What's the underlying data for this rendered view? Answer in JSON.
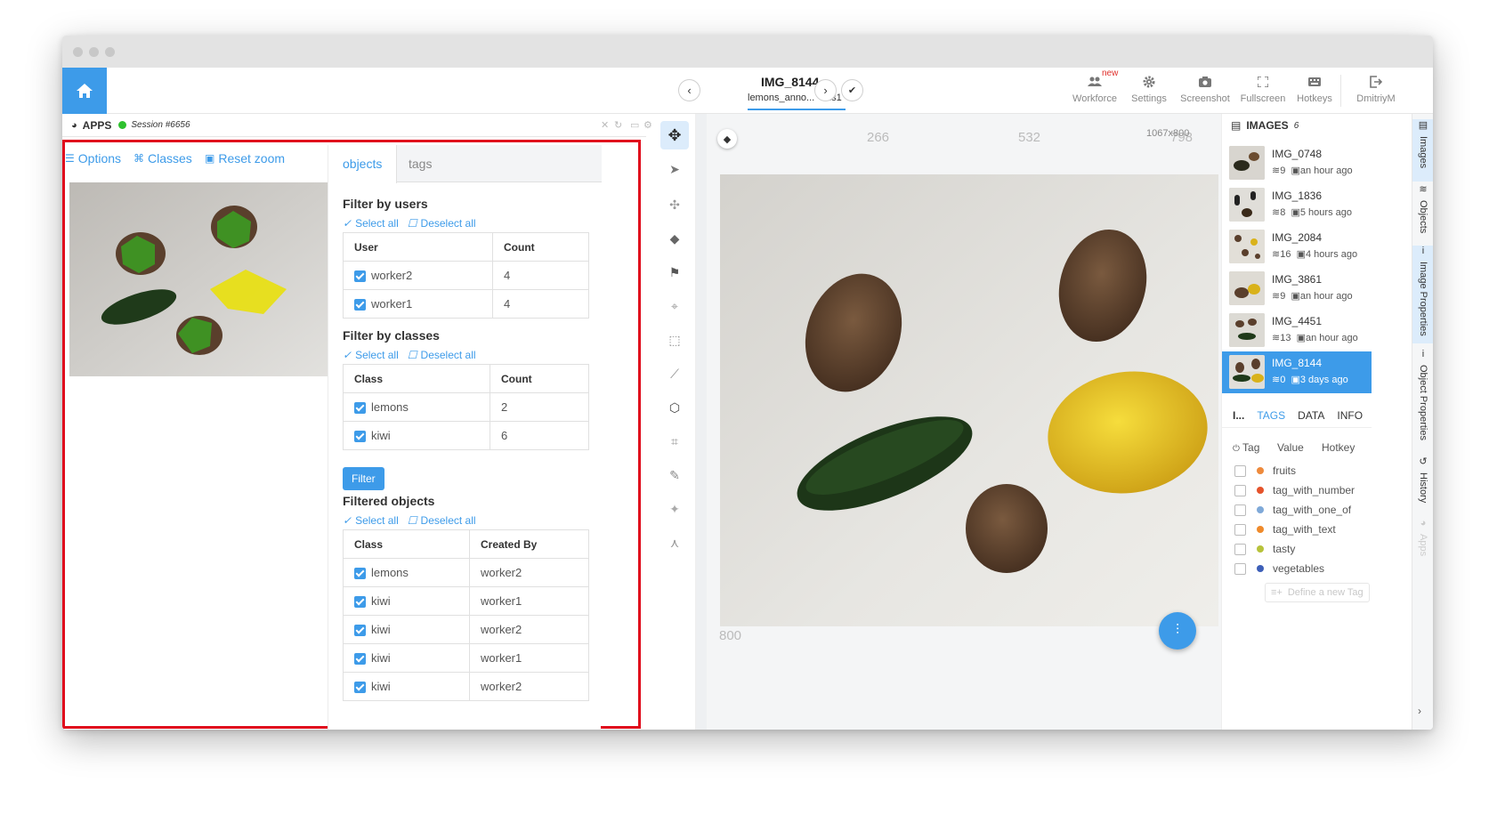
{
  "header": {
    "image_title": "IMG_8144",
    "breadcrumb_project": "lemons_anno...",
    "breadcrumb_dataset": "ds1",
    "toolbar": [
      {
        "label": "Workforce",
        "icon": "workforce-icon",
        "badge": "new"
      },
      {
        "label": "Settings",
        "icon": "gear-icon"
      },
      {
        "label": "Screenshot",
        "icon": "camera-icon"
      },
      {
        "label": "Fullscreen",
        "icon": "fullscreen-icon"
      },
      {
        "label": "Hotkeys",
        "icon": "keyboard-icon"
      },
      {
        "label": "DmitriyM",
        "icon": "logout-icon"
      }
    ]
  },
  "apps": {
    "title": "APPS",
    "session": "Session #6656",
    "links": {
      "options": "Options",
      "classes": "Classes",
      "reset_zoom": "Reset zoom"
    }
  },
  "filter_panel": {
    "tabs": [
      "objects",
      "tags"
    ],
    "active_tab": "objects",
    "select_all": "Select all",
    "deselect_all": "Deselect all",
    "filter_by_users": {
      "title": "Filter by users",
      "headers": [
        "User",
        "Count"
      ],
      "rows": [
        {
          "name": "worker2",
          "count": "4"
        },
        {
          "name": "worker1",
          "count": "4"
        }
      ]
    },
    "filter_by_classes": {
      "title": "Filter by classes",
      "headers": [
        "Class",
        "Count"
      ],
      "rows": [
        {
          "name": "lemons",
          "count": "2"
        },
        {
          "name": "kiwi",
          "count": "6"
        }
      ]
    },
    "filter_button": "Filter",
    "filtered_objects": {
      "title": "Filtered objects",
      "headers": [
        "Class",
        "Created By"
      ],
      "rows": [
        {
          "class": "lemons",
          "by": "worker2"
        },
        {
          "class": "kiwi",
          "by": "worker1"
        },
        {
          "class": "kiwi",
          "by": "worker2"
        },
        {
          "class": "kiwi",
          "by": "worker1"
        },
        {
          "class": "kiwi",
          "by": "worker2"
        }
      ]
    }
  },
  "canvas": {
    "ruler_labels": [
      "266",
      "532",
      "798"
    ],
    "dims": "1067x800",
    "left_ruler_bottom": "800"
  },
  "images_panel": {
    "title": "IMAGES",
    "count": "6",
    "images": [
      {
        "name": "IMG_0748",
        "objects": "9",
        "time": "an hour ago"
      },
      {
        "name": "IMG_1836",
        "objects": "8",
        "time": "5 hours ago"
      },
      {
        "name": "IMG_2084",
        "objects": "16",
        "time": "4 hours ago"
      },
      {
        "name": "IMG_3861",
        "objects": "9",
        "time": "an hour ago"
      },
      {
        "name": "IMG_4451",
        "objects": "13",
        "time": "an hour ago"
      },
      {
        "name": "IMG_8144",
        "objects": "0",
        "time": "3 days ago",
        "active": true
      }
    ]
  },
  "tags_panel": {
    "tabs": [
      "I...",
      "TAGS",
      "DATA",
      "INFO"
    ],
    "headers": [
      "Tag",
      "Value",
      "Hotkey"
    ],
    "tags": [
      {
        "name": "fruits",
        "color": "#ee8a3c"
      },
      {
        "name": "tag_with_number",
        "color": "#e5532b"
      },
      {
        "name": "tag_with_one_of",
        "color": "#7fa9d8"
      },
      {
        "name": "tag_with_text",
        "color": "#ef8a2b"
      },
      {
        "name": "tasty",
        "color": "#b7c23a"
      },
      {
        "name": "vegetables",
        "color": "#3d5fb8"
      }
    ],
    "define_new": "Define a new Tag"
  },
  "side_tabs": [
    "Images",
    "Objects",
    "Image Properties",
    "Object Properties",
    "History",
    "Apps"
  ]
}
